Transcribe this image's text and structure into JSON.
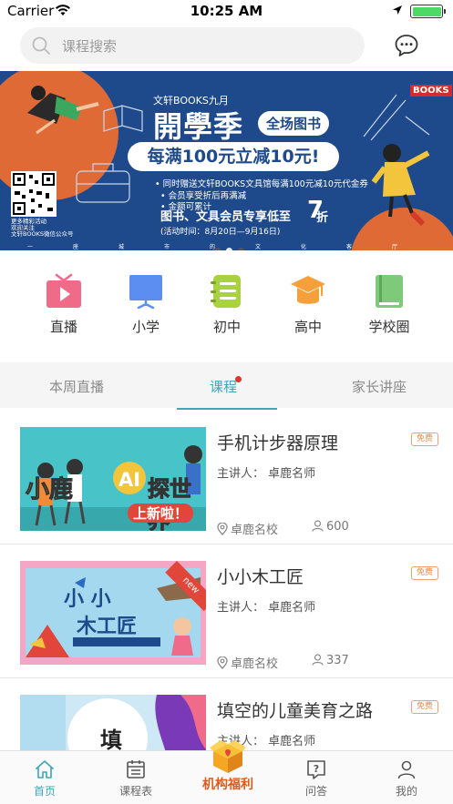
{
  "status_bar": {
    "carrier": "Carrier",
    "time": "10:25 AM"
  },
  "search": {
    "placeholder": "课程搜索"
  },
  "banner": {
    "brand": "文轩BOOKS九月",
    "logo": "BOOKS",
    "title": "開學季",
    "tag": "全场图书",
    "promo": "每满100元立减10元!",
    "line1": "• 同时赠送文轩BOOKS文具馆每满100元减10元代金券",
    "line2": "• 会员享受折后再满减",
    "line3": "• 金额可累计",
    "member": "图书、文具会员专享低至",
    "discount_num": "7",
    "discount_unit": "折",
    "period": "(活动时间：8月20日—9月16日)",
    "qr_note_1": "更多精彩活动",
    "qr_note_2": "欢迎关注",
    "qr_note_3": "文轩BOOKS微信公众号",
    "footer_chars": "一座城市的文化客厅",
    "page_count": 3,
    "active_page": 1
  },
  "categories": [
    {
      "label": "直播",
      "icon": "tv-icon",
      "color": "#f06b8a"
    },
    {
      "label": "小学",
      "icon": "board-icon",
      "color": "#5b8ef0"
    },
    {
      "label": "初中",
      "icon": "notebook-icon",
      "color": "#a8d23e"
    },
    {
      "label": "高中",
      "icon": "graduation-cap-icon",
      "color": "#f5a03a"
    },
    {
      "label": "学校圈",
      "icon": "book-icon",
      "color": "#7fc97a"
    }
  ],
  "tabs": [
    {
      "label": "本周直播",
      "active": false
    },
    {
      "label": "课程",
      "active": true,
      "has_dot": true
    },
    {
      "label": "家长讲座",
      "active": false
    }
  ],
  "courses": [
    {
      "title": "手机计步器原理",
      "badge": "免费",
      "speaker": "主讲人：  卓鹿名师",
      "location": "卓鹿名校",
      "count": "600",
      "thumb_text_1": "小鹿",
      "thumb_text_2": "AI",
      "thumb_text_3": "探世界",
      "thumb_text_4": "上新啦！"
    },
    {
      "title": "小小木工匠",
      "badge": "免费",
      "speaker": "主讲人：  卓鹿名师",
      "location": "卓鹿名校",
      "count": "337",
      "thumb_text_1": "小 小",
      "thumb_text_2": "木工匠",
      "thumb_text_3": "new"
    },
    {
      "title": "填空的儿童美育之路",
      "badge": "免费",
      "speaker": "主讲人：  卓鹿名师",
      "thumb_text_1": "填"
    }
  ],
  "bottom_nav": [
    {
      "label": "首页",
      "icon": "home-icon",
      "active": true
    },
    {
      "label": "课程表",
      "icon": "calendar-icon",
      "active": false
    },
    {
      "label": "机构福利",
      "icon": "gift-box-icon",
      "active": false,
      "center": true
    },
    {
      "label": "问答",
      "icon": "question-icon",
      "active": false
    },
    {
      "label": "我的",
      "icon": "profile-icon",
      "active": false
    }
  ],
  "colors": {
    "accent": "#3ba7b8",
    "banner_bg": "#1e4a8c",
    "banner_orange": "#e06a35",
    "free_badge": "#f08a40",
    "tab_dot": "#e0352b"
  }
}
